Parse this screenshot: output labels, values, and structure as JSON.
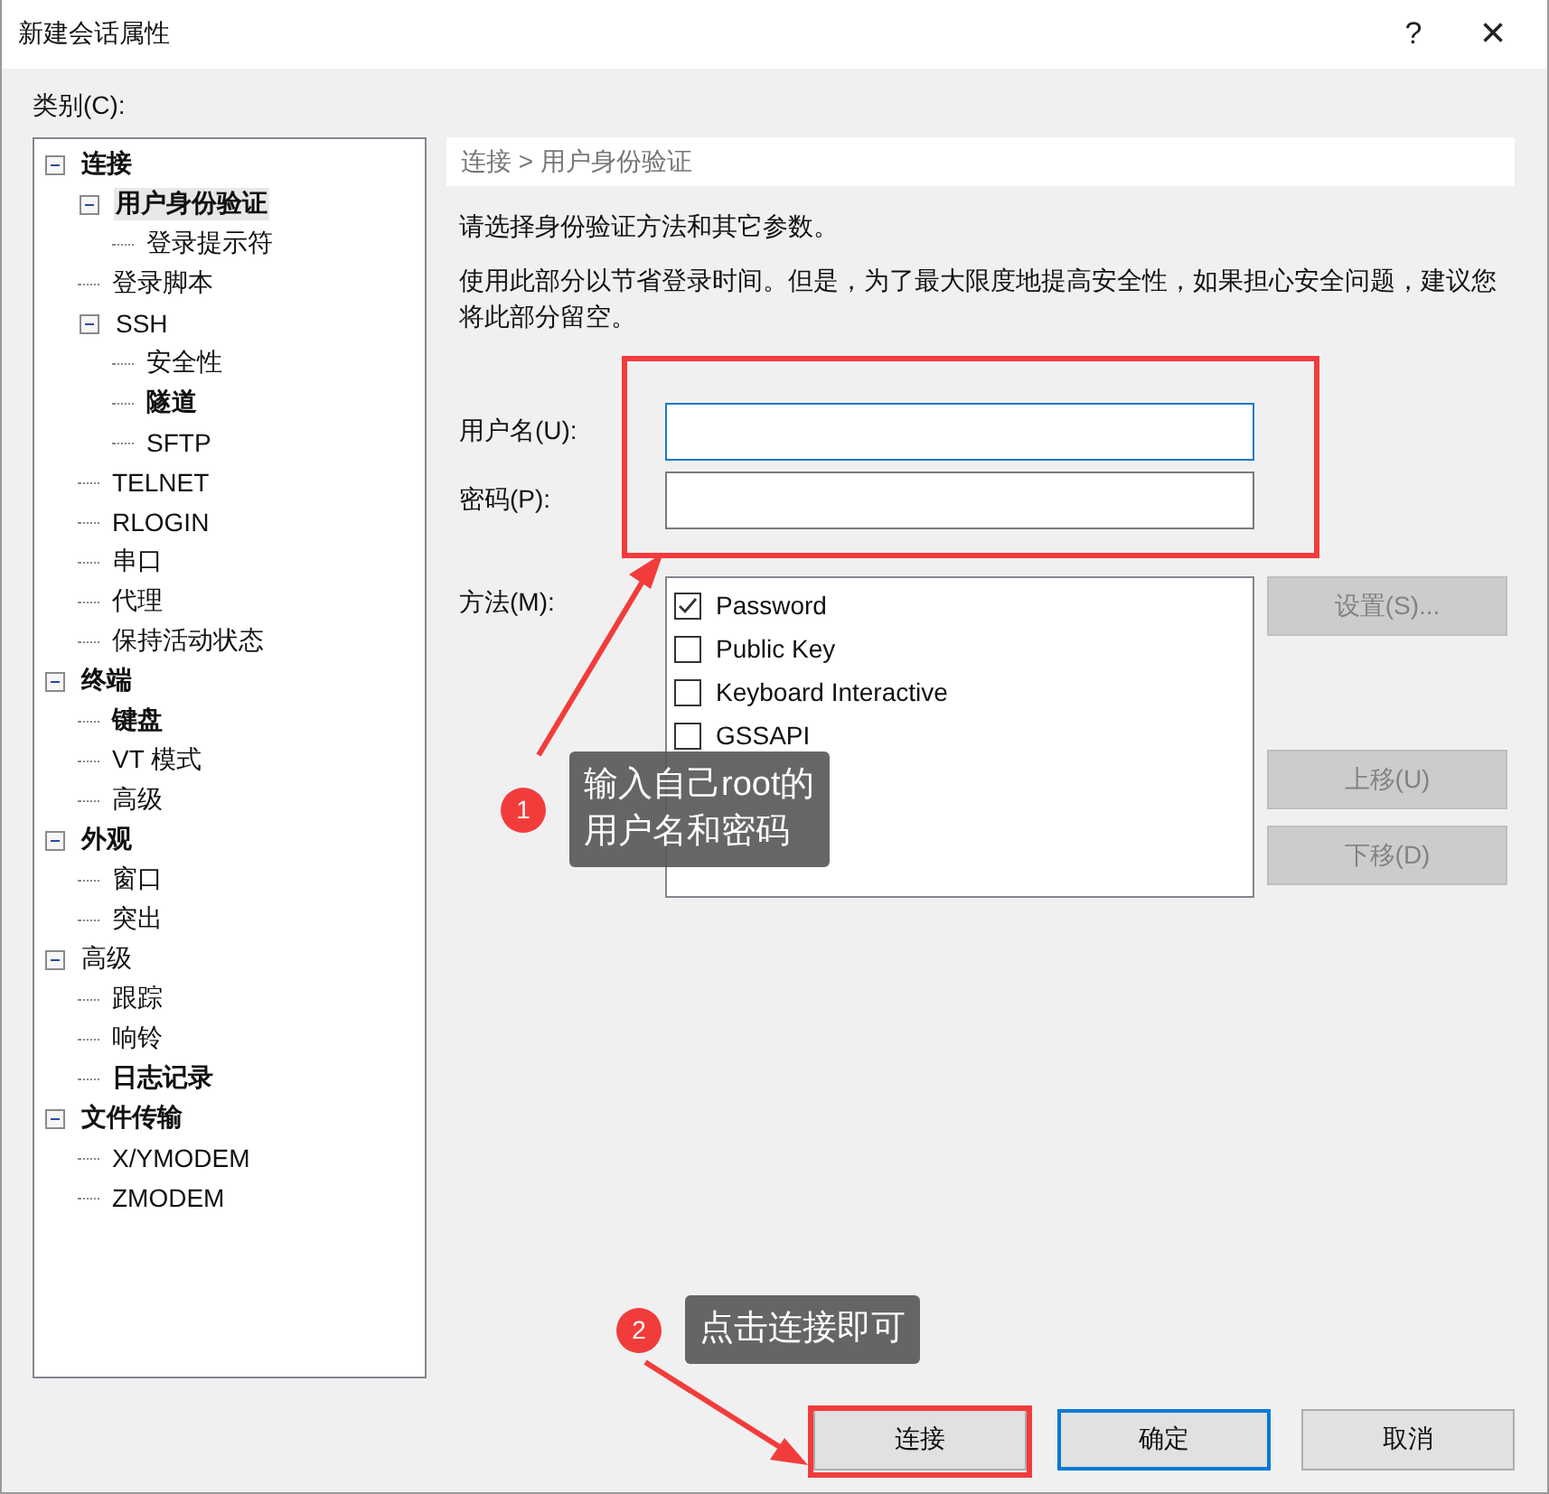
{
  "window": {
    "title": "新建会话属性",
    "help": "?",
    "close": "×"
  },
  "category_label": "类别(C):",
  "tree": [
    {
      "label": "连接",
      "bold": true,
      "selected": false,
      "expanded": true,
      "children": [
        {
          "label": "用户身份验证",
          "bold": true,
          "selected": true,
          "expanded": true,
          "children": [
            {
              "label": "登录提示符",
              "bold": false,
              "selected": false
            }
          ]
        },
        {
          "label": "登录脚本",
          "bold": false,
          "selected": false
        },
        {
          "label": "SSH",
          "bold": false,
          "selected": false,
          "expanded": true,
          "children": [
            {
              "label": "安全性",
              "bold": false,
              "selected": false
            },
            {
              "label": "隧道",
              "bold": true,
              "selected": false
            },
            {
              "label": "SFTP",
              "bold": false,
              "selected": false
            }
          ]
        },
        {
          "label": "TELNET",
          "bold": false,
          "selected": false
        },
        {
          "label": "RLOGIN",
          "bold": false,
          "selected": false
        },
        {
          "label": "串口",
          "bold": false,
          "selected": false
        },
        {
          "label": "代理",
          "bold": false,
          "selected": false
        },
        {
          "label": "保持活动状态",
          "bold": false,
          "selected": false
        }
      ]
    },
    {
      "label": "终端",
      "bold": true,
      "selected": false,
      "expanded": true,
      "children": [
        {
          "label": "键盘",
          "bold": true,
          "selected": false
        },
        {
          "label": "VT 模式",
          "bold": false,
          "selected": false
        },
        {
          "label": "高级",
          "bold": false,
          "selected": false
        }
      ]
    },
    {
      "label": "外观",
      "bold": true,
      "selected": false,
      "expanded": true,
      "children": [
        {
          "label": "窗口",
          "bold": false,
          "selected": false
        },
        {
          "label": "突出",
          "bold": false,
          "selected": false
        }
      ]
    },
    {
      "label": "高级",
      "bold": false,
      "selected": false,
      "expanded": true,
      "children": [
        {
          "label": "跟踪",
          "bold": false,
          "selected": false
        },
        {
          "label": "响铃",
          "bold": false,
          "selected": false
        },
        {
          "label": "日志记录",
          "bold": true,
          "selected": false
        }
      ]
    },
    {
      "label": "文件传输",
      "bold": true,
      "selected": false,
      "expanded": true,
      "children": [
        {
          "label": "X/YMODEM",
          "bold": false,
          "selected": false
        },
        {
          "label": "ZMODEM",
          "bold": false,
          "selected": false
        }
      ]
    }
  ],
  "breadcrumb": "连接 > 用户身份验证",
  "intro": "请选择身份验证方法和其它参数。",
  "description": "使用此部分以节省登录时间。但是，为了最大限度地提高安全性，如果担心安全问题，建议您将此部分留空。",
  "username": {
    "label": "用户名(U):"
  },
  "password": {
    "label": "密码(P):"
  },
  "methods_label": "方法(M):",
  "methods": [
    {
      "label": "Password",
      "checked": true
    },
    {
      "label": "Public Key",
      "checked": false
    },
    {
      "label": "Keyboard Interactive",
      "checked": false
    },
    {
      "label": "GSSAPI",
      "checked": false
    }
  ],
  "side_buttons": [
    {
      "label": "设置(S)...",
      "disabled": true
    },
    {
      "label": "上移(U)",
      "disabled": true
    },
    {
      "label": "下移(D)",
      "disabled": true
    }
  ],
  "buttons": [
    {
      "label": "连接",
      "default": false
    },
    {
      "label": "确定",
      "default": true
    },
    {
      "label": "取消",
      "default": false
    }
  ],
  "annotations": [
    {
      "number": "1",
      "lines": [
        "输入自己root的",
        "用户名和密码"
      ]
    },
    {
      "number": "2",
      "lines": [
        "点击连接即可"
      ]
    }
  ]
}
